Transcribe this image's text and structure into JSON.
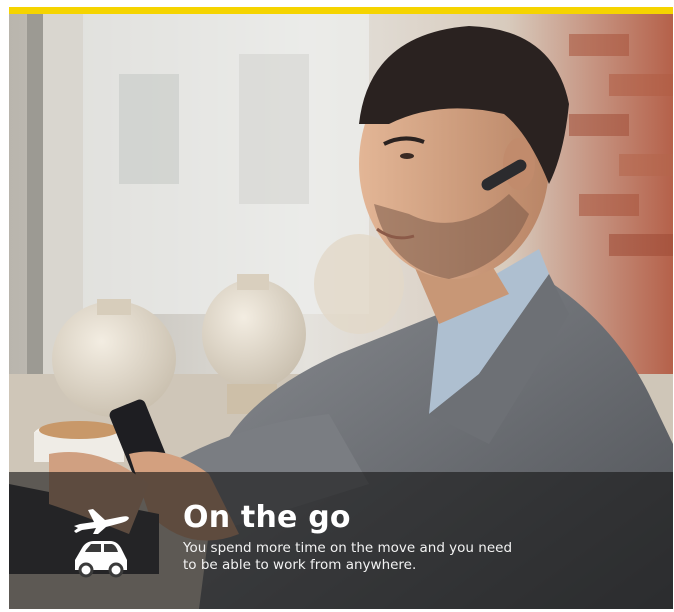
{
  "brand": {
    "accent_color": "#f5d400",
    "overlay_color": "#161616"
  },
  "caption": {
    "title": "On the go",
    "body": "You spend more time on the move and you need\nto be able to work from anywhere.",
    "icons": [
      "airplane-icon",
      "car-icon"
    ]
  }
}
